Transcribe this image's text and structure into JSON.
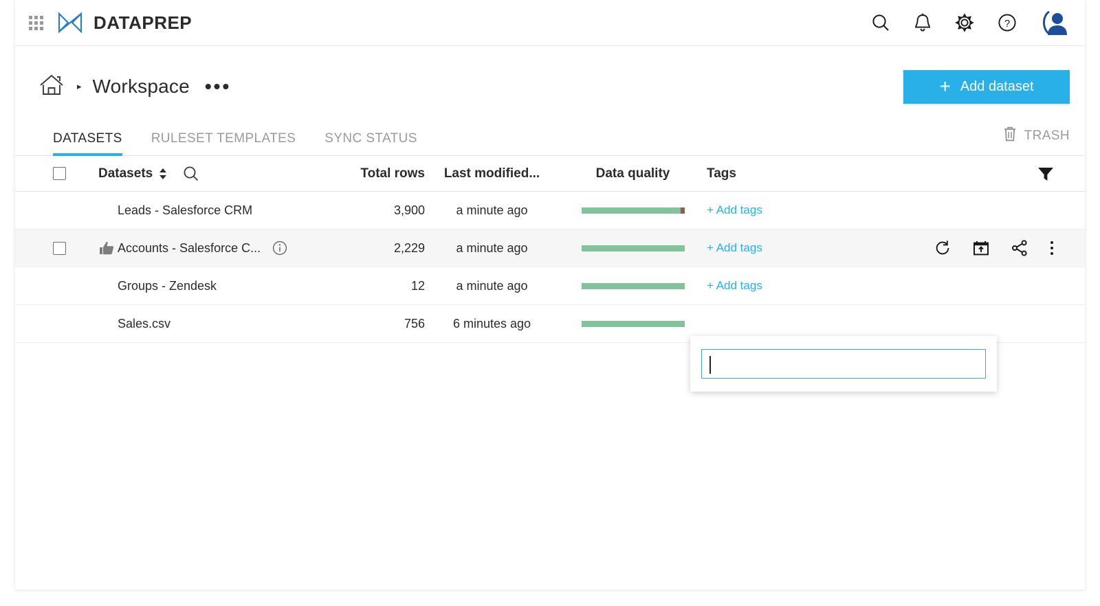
{
  "brand": {
    "name": "DATAPREP",
    "logo_icon": "dataprep-logo-icon",
    "waffle_icon": "app-launcher-icon",
    "accent_color": "#29b0e9",
    "logo_color": "#2e7fc1"
  },
  "topbar": {
    "icons": [
      {
        "name": "search-icon",
        "label": "Search"
      },
      {
        "name": "notifications-bell-icon",
        "label": "Notifications"
      },
      {
        "name": "settings-gear-icon",
        "label": "Settings"
      },
      {
        "name": "help-circle-icon",
        "label": "Help"
      },
      {
        "name": "user-avatar-icon",
        "label": "Account"
      }
    ]
  },
  "breadcrumb": {
    "home_icon": "home-icon",
    "separator": "▸",
    "title": "Workspace",
    "more_dots": "•••"
  },
  "actions": {
    "add_dataset_label": "Add dataset",
    "add_dataset_plus": "+"
  },
  "tabs": [
    {
      "label": "DATASETS",
      "active": true
    },
    {
      "label": "RULESET TEMPLATES",
      "active": false
    },
    {
      "label": "SYNC STATUS",
      "active": false
    }
  ],
  "trash": {
    "label": "TRASH",
    "icon": "trash-can-icon"
  },
  "table": {
    "columns": [
      {
        "key": "datasets",
        "label": "Datasets",
        "sortable": true,
        "searchable": true
      },
      {
        "key": "total_rows",
        "label": "Total rows"
      },
      {
        "key": "last_modified",
        "label": "Last modified..."
      },
      {
        "key": "data_quality",
        "label": "Data quality"
      },
      {
        "key": "tags",
        "label": "Tags"
      }
    ],
    "filter_icon": "filter-funnel-icon",
    "sort_icon": "sort-arrows-icon",
    "search_icon": "search-icon",
    "add_tags_label": "+ Add tags",
    "rows": [
      {
        "name": "Leads - Salesforce CRM",
        "total_rows": "3,900",
        "last_modified": "a minute ago",
        "quality_good_pct": 96,
        "quality_bad_pct": 4,
        "selected": false,
        "checkbox_visible": false,
        "has_thumb_up": false,
        "has_info": false,
        "tags": "+ Add tags",
        "show_actions": false
      },
      {
        "name": "Accounts - Salesforce C...",
        "total_rows": "2,229",
        "last_modified": "a minute ago",
        "quality_good_pct": 100,
        "quality_bad_pct": 0,
        "selected": true,
        "checkbox_visible": true,
        "has_thumb_up": true,
        "has_info": true,
        "tags": "+ Add tags",
        "show_actions": true
      },
      {
        "name": "Groups - Zendesk",
        "total_rows": "12",
        "last_modified": "a minute ago",
        "quality_good_pct": 100,
        "quality_bad_pct": 0,
        "selected": false,
        "checkbox_visible": false,
        "has_thumb_up": false,
        "has_info": false,
        "tags": "+ Add tags",
        "show_actions": false
      },
      {
        "name": "Sales.csv",
        "total_rows": "756",
        "last_modified": "6 minutes ago",
        "quality_good_pct": 100,
        "quality_bad_pct": 0,
        "selected": false,
        "checkbox_visible": false,
        "has_thumb_up": false,
        "has_info": false,
        "tags": "",
        "show_actions": false
      }
    ],
    "row_actions": [
      {
        "name": "restore-refresh-icon",
        "label": "Restore"
      },
      {
        "name": "export-box-arrow-up-icon",
        "label": "Export"
      },
      {
        "name": "share-nodes-icon",
        "label": "Share"
      },
      {
        "name": "more-vertical-dots-icon",
        "label": "More"
      }
    ]
  },
  "tags_popover": {
    "visible": true,
    "input_value": "",
    "input_placeholder": "",
    "border_color": "#4c9fe0"
  },
  "colors": {
    "quality_good": "#82c39b",
    "quality_bad": "#8a6055",
    "link": "#29b0e9",
    "muted_text": "#9b9b9b",
    "selected_row": "#f6f6f6"
  }
}
